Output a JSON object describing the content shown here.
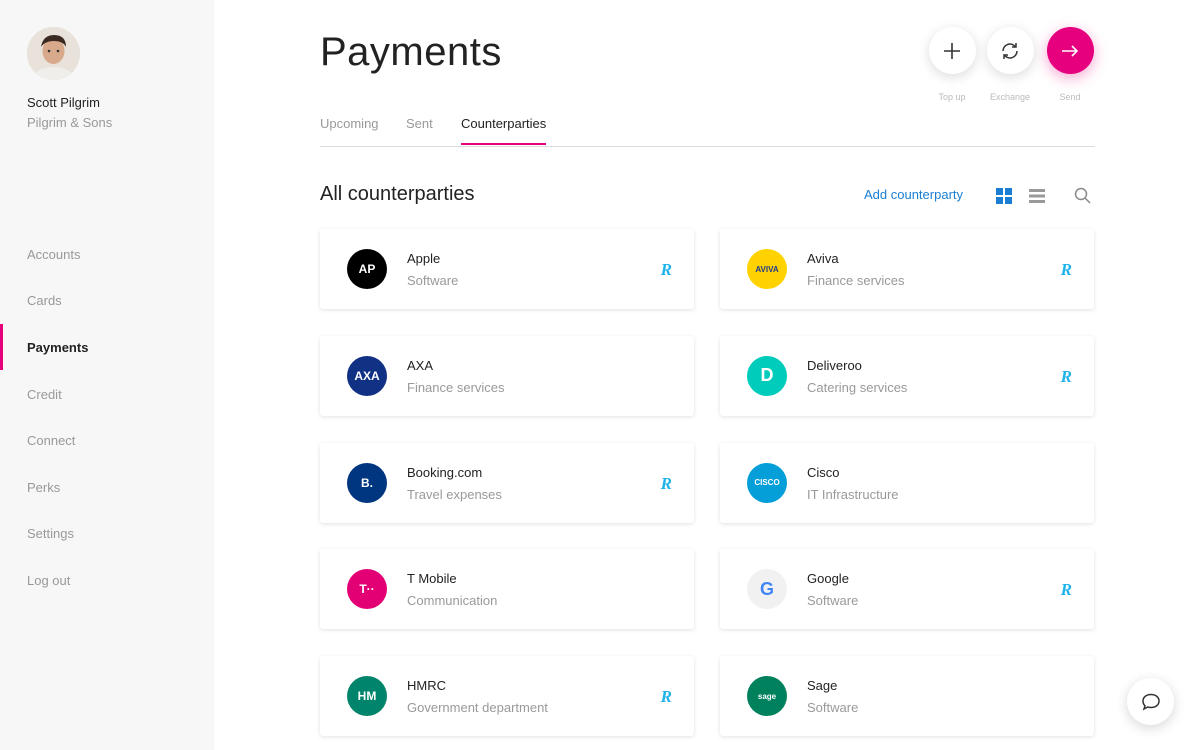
{
  "user": {
    "name": "Scott Pilgrim",
    "company": "Pilgrim & Sons"
  },
  "nav": [
    {
      "label": "Accounts"
    },
    {
      "label": "Cards"
    },
    {
      "label": "Payments",
      "active": true
    },
    {
      "label": "Credit"
    },
    {
      "label": "Connect"
    },
    {
      "label": "Perks"
    },
    {
      "label": "Settings"
    },
    {
      "label": "Log out"
    }
  ],
  "page": {
    "title": "Payments"
  },
  "actions": [
    {
      "label": "Top up",
      "icon": "plus-icon"
    },
    {
      "label": "Exchange",
      "icon": "exchange-icon"
    },
    {
      "label": "Send",
      "icon": "arrow-right-icon"
    }
  ],
  "tabs": [
    {
      "label": "Upcoming"
    },
    {
      "label": "Sent"
    },
    {
      "label": "Counterparties",
      "active": true
    }
  ],
  "section": {
    "title": "All counterparties",
    "add_label": "Add counterparty"
  },
  "badge": "R",
  "counterparties": [
    {
      "name": "Apple",
      "category": "Software",
      "logo": "AP",
      "logo_bg": "#000000",
      "logo_fg": "#ffffff",
      "revolut": true
    },
    {
      "name": "Aviva",
      "category": "Finance services",
      "logo": "AVIVA",
      "logo_bg": "#ffd200",
      "logo_fg": "#1f3b8c",
      "revolut": true
    },
    {
      "name": "AXA",
      "category": "Finance services",
      "logo": "AXA",
      "logo_bg": "#103184",
      "logo_fg": "#ffffff",
      "revolut": false
    },
    {
      "name": "Deliveroo",
      "category": "Catering services",
      "logo": "D",
      "logo_bg": "#00ccbc",
      "logo_fg": "#ffffff",
      "revolut": true
    },
    {
      "name": "Booking.com",
      "category": "Travel expenses",
      "logo": "B.",
      "logo_bg": "#003580",
      "logo_fg": "#ffffff",
      "revolut": true
    },
    {
      "name": "Cisco",
      "category": "IT Infrastructure",
      "logo": "CISCO",
      "logo_bg": "#049fd9",
      "logo_fg": "#ffffff",
      "revolut": false
    },
    {
      "name": "T Mobile",
      "category": "Communication",
      "logo": "T··",
      "logo_bg": "#e20074",
      "logo_fg": "#ffffff",
      "revolut": false
    },
    {
      "name": "Google",
      "category": "Software",
      "logo": "G",
      "logo_bg": "#f1f1f1",
      "logo_fg": "#4285f4",
      "revolut": true
    },
    {
      "name": "HMRC",
      "category": "Government department",
      "logo": "HM",
      "logo_bg": "#00846b",
      "logo_fg": "#ffffff",
      "revolut": true
    },
    {
      "name": "Sage",
      "category": "Software",
      "logo": "sage",
      "logo_bg": "#00815d",
      "logo_fg": "#ffffff",
      "revolut": false
    }
  ],
  "colors": {
    "accent": "#e6007e",
    "link": "#1a7fd4",
    "badge": "#1fb3e8"
  }
}
